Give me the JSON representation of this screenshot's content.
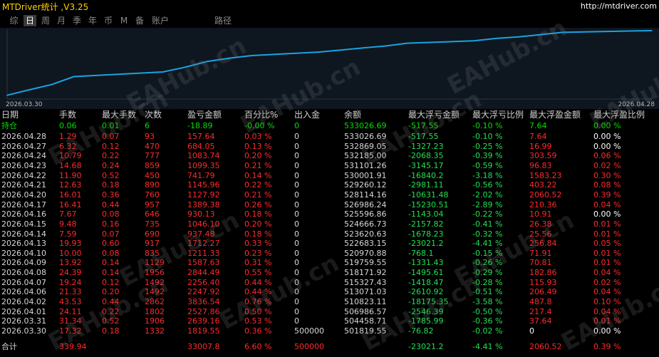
{
  "app": {
    "title": "MTDriver统计 ,V3.25",
    "url": "http://mtdriver.com"
  },
  "tabs": [
    {
      "label": "综",
      "active": false
    },
    {
      "label": "日",
      "active": true
    },
    {
      "label": "周",
      "active": false
    },
    {
      "label": "月",
      "active": false
    },
    {
      "label": "季",
      "active": false
    },
    {
      "label": "年",
      "active": false
    },
    {
      "label": "币",
      "active": false
    },
    {
      "label": "M",
      "active": false
    },
    {
      "label": "备",
      "active": false
    },
    {
      "label": "账户",
      "active": false
    },
    {
      "label": "路径",
      "active": false
    }
  ],
  "chart_data": {
    "type": "line",
    "x_start_label": "2026.03.30",
    "x_end_label": "2026.04.28",
    "color": "#1aa3e0",
    "x": [
      "2026.03.30",
      "2026.03.31",
      "2026.04.01",
      "2026.04.02",
      "2026.04.06",
      "2026.04.07",
      "2026.04.08",
      "2026.04.09",
      "2026.04.10",
      "2026.04.13",
      "2026.04.14",
      "2026.04.15",
      "2026.04.16",
      "2026.04.17",
      "2026.04.20",
      "2026.04.21",
      "2026.04.22",
      "2026.04.23",
      "2026.04.24",
      "2026.04.27",
      "2026.04.28"
    ],
    "values": [
      501819.55,
      504458.71,
      506986.57,
      510823.11,
      513071.03,
      515327.43,
      518171.92,
      519759.55,
      520970.88,
      522683.15,
      523620.63,
      524666.73,
      525596.86,
      526986.24,
      528114.16,
      529260.12,
      530001.91,
      531101.26,
      532185.0,
      532869.05,
      533026.69
    ]
  },
  "table": {
    "headers": [
      "日期",
      "手数",
      "最大手数",
      "次数",
      "盈亏金额",
      "百分比%",
      "出入金",
      "余额",
      "最大浮亏金额",
      "最大浮亏比例",
      "最大浮盈金额",
      "最大浮盈比例"
    ],
    "holding": [
      "持仓",
      "0.06",
      "0.01",
      "6",
      "-18.89",
      "-0.00 %",
      "0",
      "533026.69",
      "-517.55",
      "-0.10 %",
      "7.64",
      "0.00 %"
    ],
    "rows": [
      [
        "2026.04.28",
        "1.29",
        "0.07",
        "93",
        "157.64",
        "0.03 %",
        "0",
        "533026.69",
        "-517.55",
        "-0.10 %",
        "7.64",
        "0.00 %"
      ],
      [
        "2026.04.27",
        "6.32",
        "0.12",
        "470",
        "684.05",
        "0.13 %",
        "0",
        "532869.05",
        "-1327.23",
        "-0.25 %",
        "16.99",
        "0.00 %"
      ],
      [
        "2026.04.24",
        "10.79",
        "0.22",
        "777",
        "1083.74",
        "0.20 %",
        "0",
        "532185.00",
        "-2068.35",
        "-0.39 %",
        "303.59",
        "0.06 %"
      ],
      [
        "2026.04.23",
        "14.68",
        "0.24",
        "859",
        "1099.35",
        "0.21 %",
        "0",
        "531101.26",
        "-3145.17",
        "-0.59 %",
        "96.83",
        "0.02 %"
      ],
      [
        "2026.04.22",
        "11.90",
        "0.52",
        "450",
        "741.79",
        "0.14 %",
        "0",
        "530001.91",
        "-16840.2",
        "-3.18 %",
        "1583.23",
        "0.30 %"
      ],
      [
        "2026.04.21",
        "12.63",
        "0.18",
        "890",
        "1145.96",
        "0.22 %",
        "0",
        "529260.12",
        "-2981.11",
        "-0.56 %",
        "403.22",
        "0.08 %"
      ],
      [
        "2026.04.20",
        "16.01",
        "0.36",
        "760",
        "1127.92",
        "0.21 %",
        "0",
        "528114.16",
        "-10631.48",
        "-2.02 %",
        "2060.52",
        "0.39 %"
      ],
      [
        "2026.04.17",
        "16.41",
        "0.44",
        "957",
        "1389.38",
        "0.26 %",
        "0",
        "526986.24",
        "-15230.51",
        "-2.89 %",
        "210.36",
        "0.04 %"
      ],
      [
        "2026.04.16",
        "7.67",
        "0.08",
        "646",
        "930.13",
        "0.18 %",
        "0",
        "525596.86",
        "-1143.04",
        "-0.22 %",
        "10.91",
        "0.00 %"
      ],
      [
        "2026.04.15",
        "9.48",
        "0.16",
        "735",
        "1046.10",
        "0.20 %",
        "0",
        "524666.73",
        "-2157.82",
        "-0.41 %",
        "26.38",
        "0.01 %"
      ],
      [
        "2026.04.14",
        "7.59",
        "0.07",
        "690",
        "937.48",
        "0.18 %",
        "0",
        "523620.63",
        "-1678.23",
        "-0.32 %",
        "25.56",
        "0.01 %"
      ],
      [
        "2026.04.13",
        "19.93",
        "0.60",
        "917",
        "1712.27",
        "0.33 %",
        "0",
        "522683.15",
        "-23021.2",
        "-4.41 %",
        "256.84",
        "0.05 %"
      ],
      [
        "2026.04.10",
        "10.00",
        "0.08",
        "835",
        "1211.33",
        "0.23 %",
        "0",
        "520970.88",
        "-768.1",
        "-0.15 %",
        "71.91",
        "0.01 %"
      ],
      [
        "2026.04.09",
        "13.92",
        "0.14",
        "1129",
        "1587.63",
        "0.31 %",
        "0",
        "519759.55",
        "-1331.43",
        "-0.26 %",
        "70.81",
        "0.01 %"
      ],
      [
        "2026.04.08",
        "24.39",
        "0.14",
        "1956",
        "2844.49",
        "0.55 %",
        "0",
        "518171.92",
        "-1495.61",
        "-0.29 %",
        "182.86",
        "0.04 %"
      ],
      [
        "2026.04.07",
        "19.24",
        "0.12",
        "1492",
        "2256.40",
        "0.44 %",
        "0",
        "515327.43",
        "-1418.47",
        "-0.28 %",
        "115.93",
        "0.02 %"
      ],
      [
        "2026.04.06",
        "21.33",
        "0.20",
        "1492",
        "2247.92",
        "0.44 %",
        "0",
        "513071.03",
        "-2610.92",
        "-0.51 %",
        "206.49",
        "0.04 %"
      ],
      [
        "2026.04.02",
        "43.53",
        "0.44",
        "2862",
        "3836.54",
        "0.76 %",
        "0",
        "510823.11",
        "-18175.35",
        "-3.58 %",
        "487.8",
        "0.10 %"
      ],
      [
        "2026.04.01",
        "24.11",
        "0.22",
        "1802",
        "2527.86",
        "0.50 %",
        "0",
        "506986.57",
        "-2546.39",
        "-0.50 %",
        "217.4",
        "0.04 %"
      ],
      [
        "2026.03.31",
        "31.34",
        "0.52",
        "1906",
        "2639.16",
        "0.53 %",
        "0",
        "504458.71",
        "-1785.99",
        "-0.36 %",
        "37.64",
        "0.01 %"
      ],
      [
        "2026.03.30",
        "17.32",
        "0.18",
        "1332",
        "1819.55",
        "0.36 %",
        "500000",
        "501819.55",
        "-76.82",
        "-0.02 %",
        "0",
        "0.00 %"
      ]
    ],
    "total": [
      "合计",
      "339.94",
      "",
      "",
      "33007.8",
      "6.60 %",
      "500000",
      "",
      "-23021.2",
      "-4.41 %",
      "2060.52",
      "0.39 %"
    ]
  },
  "watermark": "EAHub.cn"
}
